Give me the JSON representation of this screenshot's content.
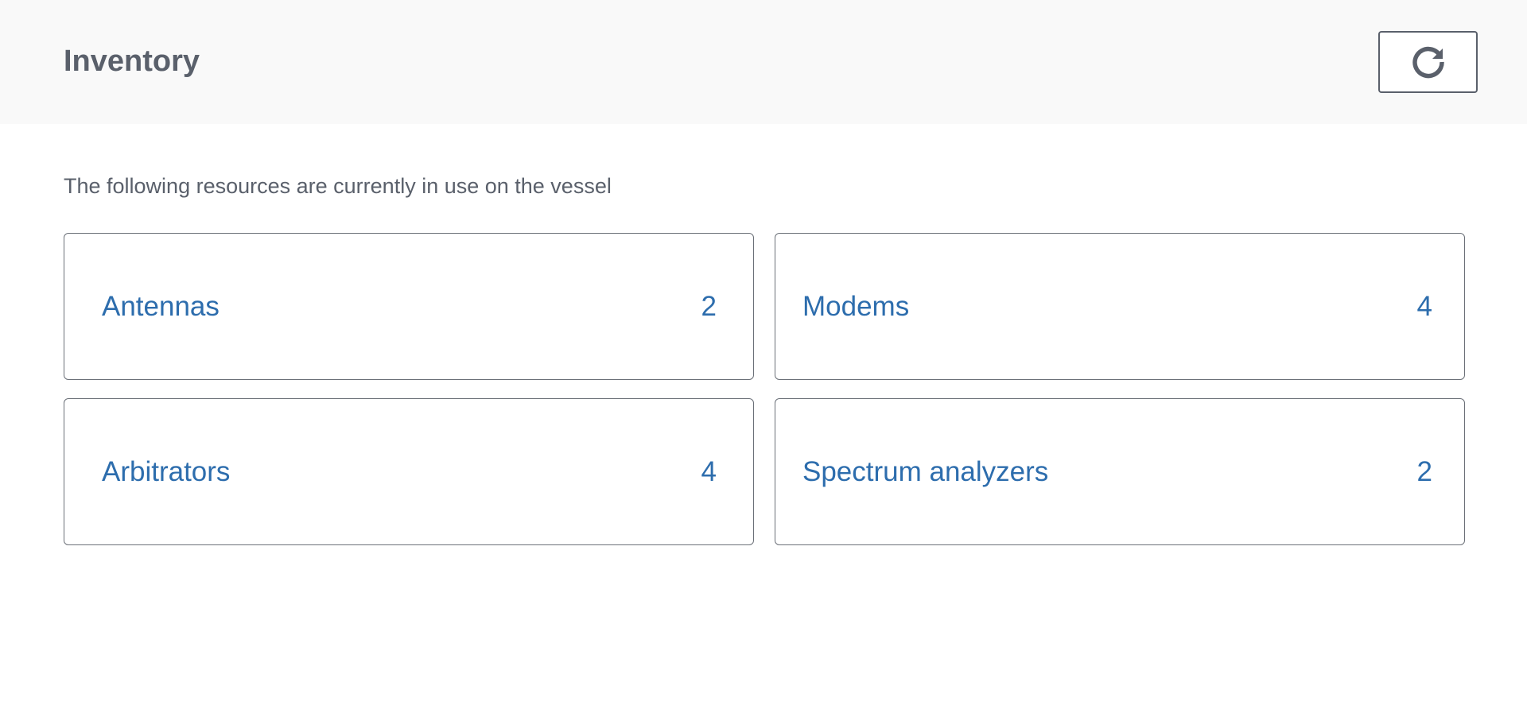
{
  "header": {
    "title": "Inventory",
    "refresh_icon": "refresh-icon"
  },
  "main": {
    "intro": "The following resources are currently in use on the vessel",
    "cards": [
      {
        "label": "Antennas",
        "count": "2"
      },
      {
        "label": "Modems",
        "count": "4"
      },
      {
        "label": "Arbitrators",
        "count": "4"
      },
      {
        "label": "Spectrum analyzers",
        "count": "2"
      }
    ]
  },
  "colors": {
    "header_background": "#f9f9f9",
    "title_text": "#5a606b",
    "card_text": "#2d6dad",
    "card_border": "#6b7078"
  }
}
